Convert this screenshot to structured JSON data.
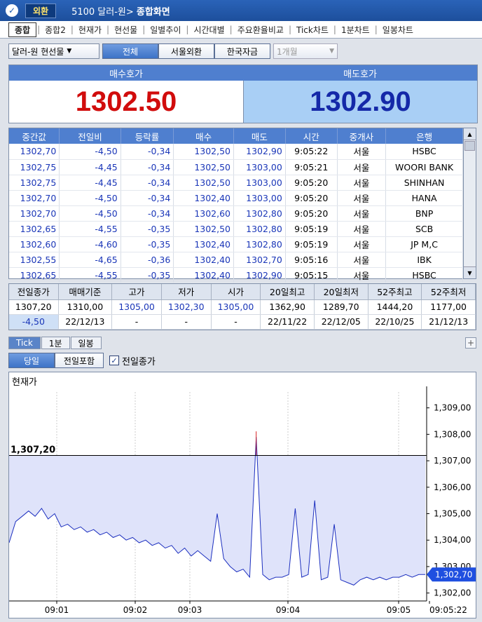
{
  "titlebar": {
    "badge": "외환",
    "screen_code": "5100 달러-원",
    "screen_name": "종합화면"
  },
  "tabs": [
    "종합",
    "종합2",
    "현재가",
    "현선물",
    "일별추이",
    "시간대별",
    "주요환율비교",
    "Tick차트",
    "1분차트",
    "일봉차트"
  ],
  "filters": {
    "instrument": "달러-원 현선물",
    "segments": [
      "전체",
      "서울외환",
      "한국자금"
    ],
    "active_segment": "전체",
    "period": "1개월"
  },
  "quote": {
    "bid_label": "매수호가",
    "bid": "1302.50",
    "ask_label": "매도호가",
    "ask": "1302.90"
  },
  "ticks": {
    "columns": [
      "중간값",
      "전일비",
      "등락률",
      "매수",
      "매도",
      "시간",
      "중개사",
      "은행"
    ],
    "rows": [
      [
        "1302,70",
        "-4,50",
        "-0,34",
        "1302,50",
        "1302,90",
        "9:05:22",
        "서울",
        "HSBC"
      ],
      [
        "1302,75",
        "-4,45",
        "-0,34",
        "1302,50",
        "1303,00",
        "9:05:21",
        "서울",
        "WOORI BANK"
      ],
      [
        "1302,75",
        "-4,45",
        "-0,34",
        "1302,50",
        "1303,00",
        "9:05:20",
        "서울",
        "SHINHAN"
      ],
      [
        "1302,70",
        "-4,50",
        "-0,34",
        "1302,40",
        "1303,00",
        "9:05:20",
        "서울",
        "HANA"
      ],
      [
        "1302,70",
        "-4,50",
        "-0,34",
        "1302,60",
        "1302,80",
        "9:05:20",
        "서울",
        "BNP"
      ],
      [
        "1302,65",
        "-4,55",
        "-0,35",
        "1302,50",
        "1302,80",
        "9:05:19",
        "서울",
        "SCB"
      ],
      [
        "1302,60",
        "-4,60",
        "-0,35",
        "1302,40",
        "1302,80",
        "9:05:19",
        "서울",
        "JP M,C"
      ],
      [
        "1302,55",
        "-4,65",
        "-0,36",
        "1302,40",
        "1302,70",
        "9:05:16",
        "서울",
        "IBK"
      ],
      [
        "1302,65",
        "-4,55",
        "-0,35",
        "1302,40",
        "1302,90",
        "9:05:15",
        "서울",
        "HSBC"
      ]
    ]
  },
  "summary": {
    "columns": [
      "전일종가",
      "매매기준",
      "고가",
      "저가",
      "시가",
      "20일최고",
      "20일최저",
      "52주최고",
      "52주최저"
    ],
    "row1": [
      "1307,20",
      "1310,00",
      "1305,00",
      "1302,30",
      "1305,00",
      "1362,90",
      "1289,70",
      "1444,20",
      "1177,00"
    ],
    "row2": [
      "-4,50",
      "22/12/13",
      "-",
      "-",
      "-",
      "22/11/22",
      "22/12/05",
      "22/10/25",
      "21/12/13"
    ]
  },
  "chart_tabs": [
    "Tick",
    "1분",
    "일봉"
  ],
  "chart_opts": {
    "segments": [
      "당일",
      "전일포함"
    ],
    "checkbox_label": "전일종가",
    "checked_mark": "✓"
  },
  "chart_data": {
    "type": "line",
    "title": "현재가",
    "yticks": [
      "1,309,00",
      "1,308,00",
      "1,307,00",
      "1,306,00",
      "1,305,00",
      "1,304,00",
      "1,303,00",
      "1,302,00"
    ],
    "ylim": [
      1301.7,
      1309.6
    ],
    "xticks": [
      "09:01",
      "09:02",
      "09:03",
      "09:04",
      "09:05",
      "09:05:22"
    ],
    "prev_close": 1307.2,
    "prev_close_label": "1,307,20",
    "current_label": "1,302,70",
    "current": 1302.7,
    "series": [
      1303.9,
      1304.7,
      1304.9,
      1305.1,
      1304.9,
      1305.2,
      1304.8,
      1305.0,
      1304.5,
      1304.6,
      1304.4,
      1304.5,
      1304.3,
      1304.4,
      1304.2,
      1304.3,
      1304.1,
      1304.2,
      1304.0,
      1304.1,
      1303.9,
      1304.0,
      1303.8,
      1303.9,
      1303.7,
      1303.8,
      1303.5,
      1303.7,
      1303.4,
      1303.6,
      1303.4,
      1303.2,
      1305.0,
      1303.3,
      1303.0,
      1302.8,
      1302.9,
      1302.6,
      1307.9,
      1302.7,
      1302.5,
      1302.6,
      1302.6,
      1302.7,
      1305.2,
      1302.6,
      1302.7,
      1305.5,
      1302.5,
      1302.6,
      1304.6,
      1302.5,
      1302.4,
      1302.3,
      1302.5,
      1302.6,
      1302.5,
      1302.6,
      1302.5,
      1302.6,
      1302.6,
      1302.7,
      1302.6,
      1302.7,
      1302.7
    ]
  }
}
